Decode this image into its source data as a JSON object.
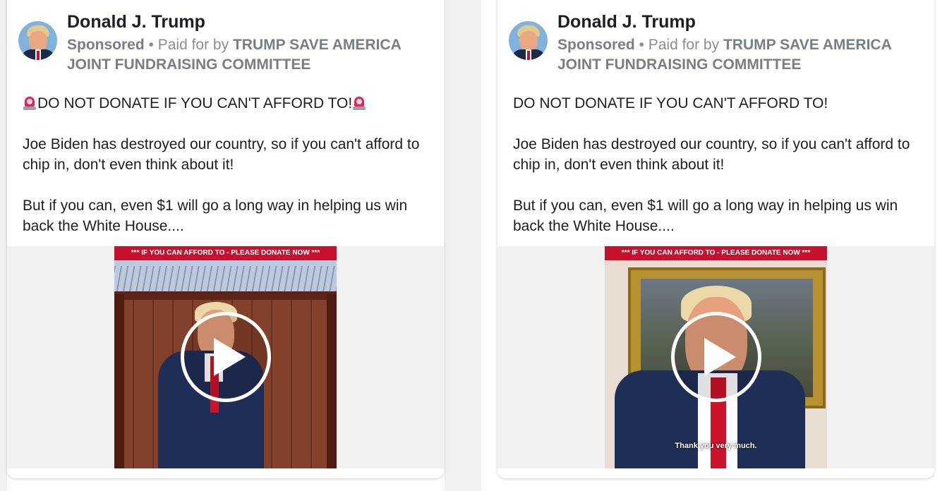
{
  "posts": [
    {
      "page_name": "Donald J. Trump",
      "sponsored_label": "Sponsored",
      "separator": " • ",
      "paid_for_prefix": "Paid for by ",
      "paid_for_by": "TRUMP SAVE AMERICA JOINT FUNDRAISING COMMITTEE",
      "headline_has_sirens": true,
      "headline": "DO NOT DONATE IF YOU CAN'T AFFORD TO!",
      "paragraph_1": "Joe Biden has destroyed our country, so if you can't afford to chip in, don't even think about it!",
      "paragraph_2": "But if you can, even $1 will go a long way in helping us win back the White House....",
      "video_banner": "*** IF YOU CAN AFFORD TO - PLEASE DONATE NOW ***",
      "video_caption": "",
      "icons": {
        "avatar": "profile-photo",
        "siren": "police-siren-emoji",
        "play": "play-icon"
      }
    },
    {
      "page_name": "Donald J. Trump",
      "sponsored_label": "Sponsored",
      "separator": " • ",
      "paid_for_prefix": "Paid for by ",
      "paid_for_by": "TRUMP SAVE AMERICA JOINT FUNDRAISING COMMITTEE",
      "headline_has_sirens": false,
      "headline": "DO NOT DONATE IF YOU CAN'T AFFORD TO!",
      "paragraph_1": "Joe Biden has destroyed our country, so if you can't afford to chip in, don't even think about it!",
      "paragraph_2": "But if you can, even $1 will go a long way in helping us win back the White House....",
      "video_banner": "*** IF YOU CAN AFFORD TO - PLEASE DONATE NOW ***",
      "video_caption": "Thank you very much.",
      "icons": {
        "avatar": "profile-photo",
        "play": "play-icon"
      }
    }
  ],
  "colors": {
    "banner_red": "#c8102e",
    "page_background": "#f0f0f0",
    "card_background": "#ffffff",
    "muted_text": "#8a8d91"
  }
}
